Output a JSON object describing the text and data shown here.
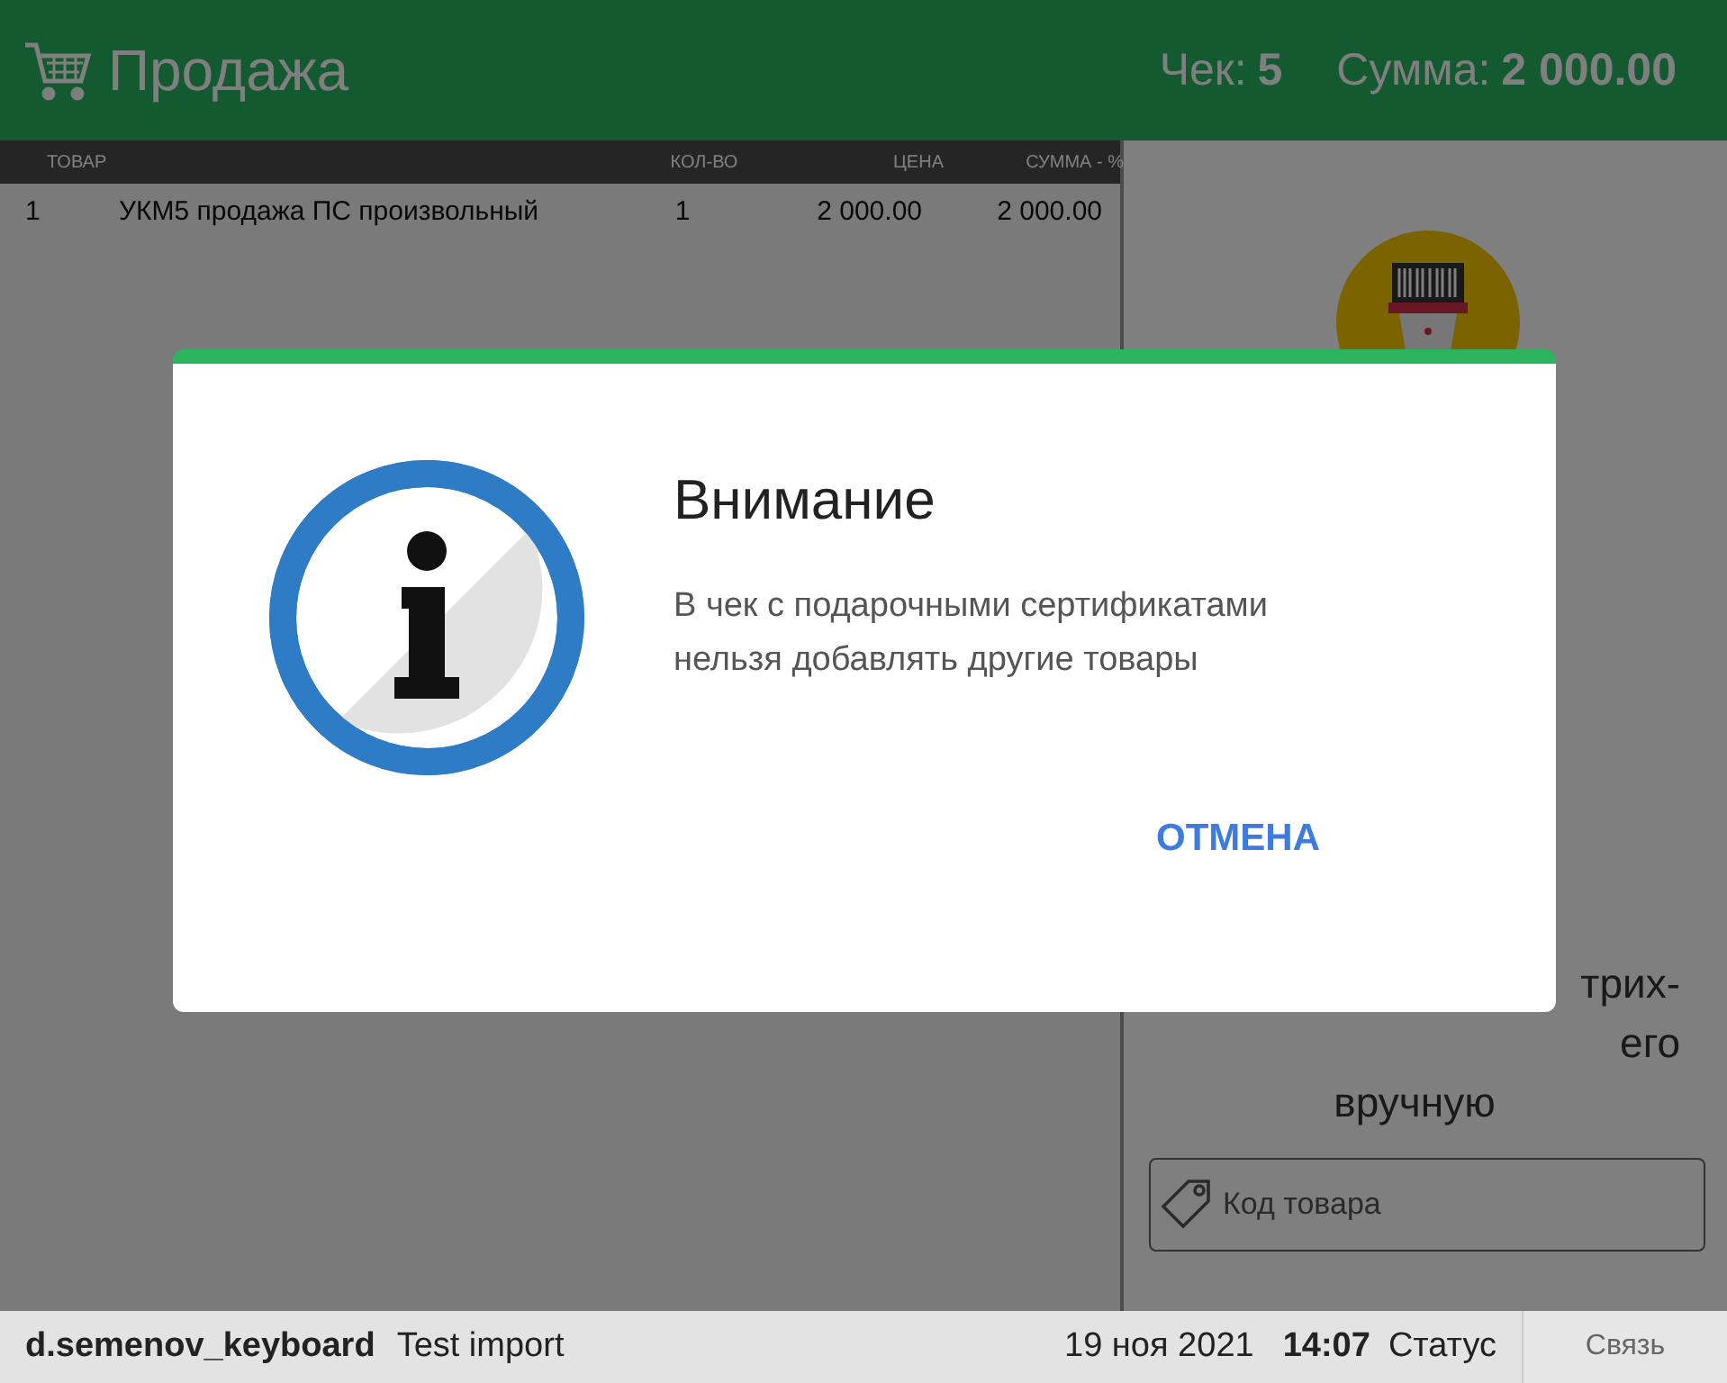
{
  "header": {
    "title": "Продажа",
    "check_label": "Чек:",
    "check_number": "5",
    "sum_label": "Сумма:",
    "sum_value": "2 000.00"
  },
  "table": {
    "columns": [
      "ТОВАР",
      "КОЛ-ВО",
      "ЦЕНА",
      "СУММА - %"
    ],
    "rows": [
      {
        "index": "1",
        "name": "УКМ5 продажа ПС произвольный",
        "qty": "1",
        "price": "2 000.00",
        "sum": "2 000.00"
      }
    ]
  },
  "scan_panel": {
    "hint_lines": [
      "трих-",
      "его",
      "вручную"
    ],
    "code_field": {
      "placeholder": "Код товара"
    }
  },
  "dialog": {
    "title": "Внимание",
    "message": "В чек с подарочными сертификатами нельзя добавлять другие товары",
    "buttons": [
      "ОТМЕНА"
    ]
  },
  "status_bar": {
    "user": "d.semenov_keyboard",
    "shop": "Test import",
    "date": "19 ноя 2021",
    "time": "14:07",
    "status": "Статус",
    "link_button": "Связь"
  }
}
